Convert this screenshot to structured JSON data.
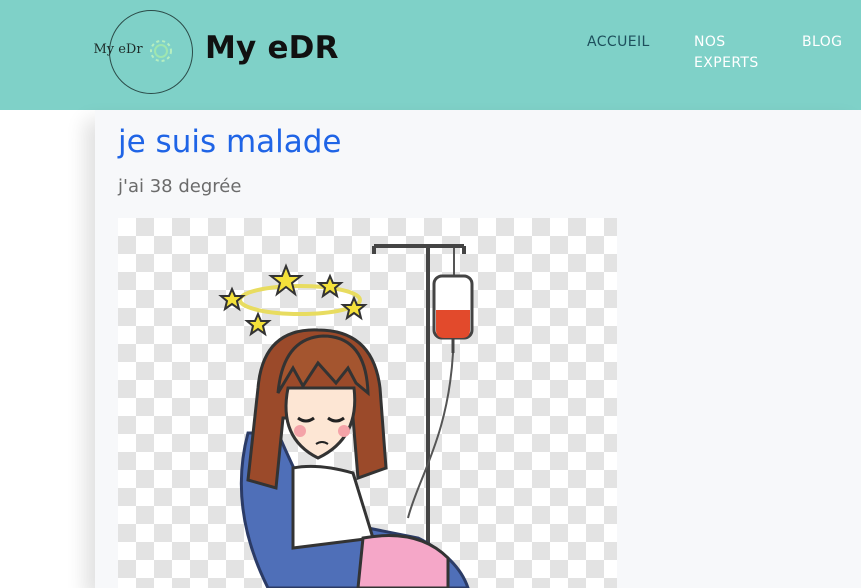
{
  "header": {
    "logo_text": "My eDr",
    "brand": "My eDR",
    "nav": {
      "accueil": "ACCUEIL",
      "nos_experts": "NOS EXPERTS",
      "blog": "BLOG"
    }
  },
  "post": {
    "title": "je suis malade",
    "subtitle": "j'ai 38 degrée",
    "image_icon": "sick-girl-iv-drip-illustration"
  },
  "colors": {
    "header_bg": "#7fd1c8",
    "title_link": "#1f64e6",
    "nav_active": "#1d4f5c",
    "nav_inactive": "#ffffff"
  }
}
